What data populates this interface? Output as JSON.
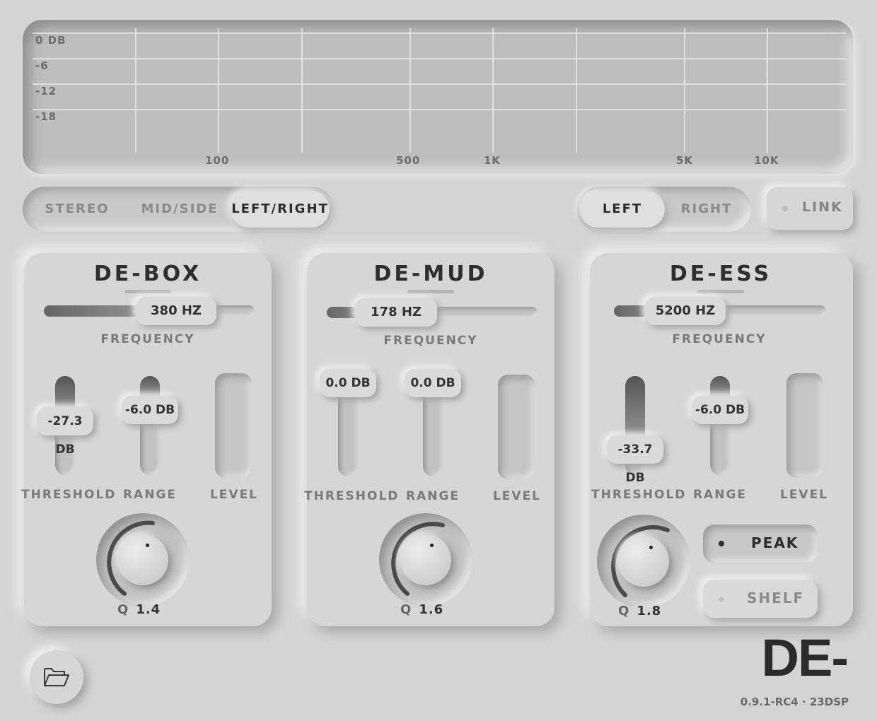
{
  "graph": {
    "db_labels": [
      "0 DB",
      "-6",
      "-12",
      "-18"
    ],
    "hz_labels": [
      "100",
      "500",
      "1K",
      "5K",
      "10K"
    ]
  },
  "mode_selector": {
    "options": [
      "STEREO",
      "MID/SIDE",
      "LEFT/RIGHT"
    ],
    "selected": "LEFT/RIGHT"
  },
  "channel_selector": {
    "options": [
      "LEFT",
      "RIGHT"
    ],
    "selected": "LEFT"
  },
  "link": {
    "label": "LINK",
    "active": false
  },
  "panels": [
    {
      "title": "DE-BOX",
      "frequency": {
        "label": "FREQUENCY",
        "value": "380 HZ",
        "fraction": 0.45
      },
      "threshold": {
        "label": "THRESHOLD",
        "value": "-27.3 DB",
        "fraction": 0.45
      },
      "range": {
        "label": "RANGE",
        "value": "-6.0 DB",
        "fraction": 0.2
      },
      "level": {
        "label": "LEVEL"
      },
      "q": {
        "label": "Q",
        "value": "1.4"
      }
    },
    {
      "title": "DE-MUD",
      "frequency": {
        "label": "FREQUENCY",
        "value": "178 HZ",
        "fraction": 0.2
      },
      "threshold": {
        "label": "THRESHOLD",
        "value": "0.0 DB",
        "fraction": 0.0
      },
      "range": {
        "label": "RANGE",
        "value": "0.0 DB",
        "fraction": 0.0
      },
      "level": {
        "label": "LEVEL"
      },
      "q": {
        "label": "Q",
        "value": "1.6"
      }
    },
    {
      "title": "DE-ESS",
      "frequency": {
        "label": "FREQUENCY",
        "value": "5200 HZ",
        "fraction": 0.27
      },
      "threshold": {
        "label": "THRESHOLD",
        "value": "-33.7 DB",
        "fraction": 0.72
      },
      "range": {
        "label": "RANGE",
        "value": "-6.0 DB",
        "fraction": 0.2
      },
      "level": {
        "label": "LEVEL"
      },
      "q": {
        "label": "Q",
        "value": "1.8"
      },
      "filter_modes": [
        {
          "label": "PEAK",
          "active": true
        },
        {
          "label": "SHELF",
          "active": false
        }
      ]
    }
  ],
  "footer": {
    "open_preset_icon": "folder-open-icon",
    "brand": "DE-",
    "version": "0.9.1-RC4 · 23DSP"
  }
}
